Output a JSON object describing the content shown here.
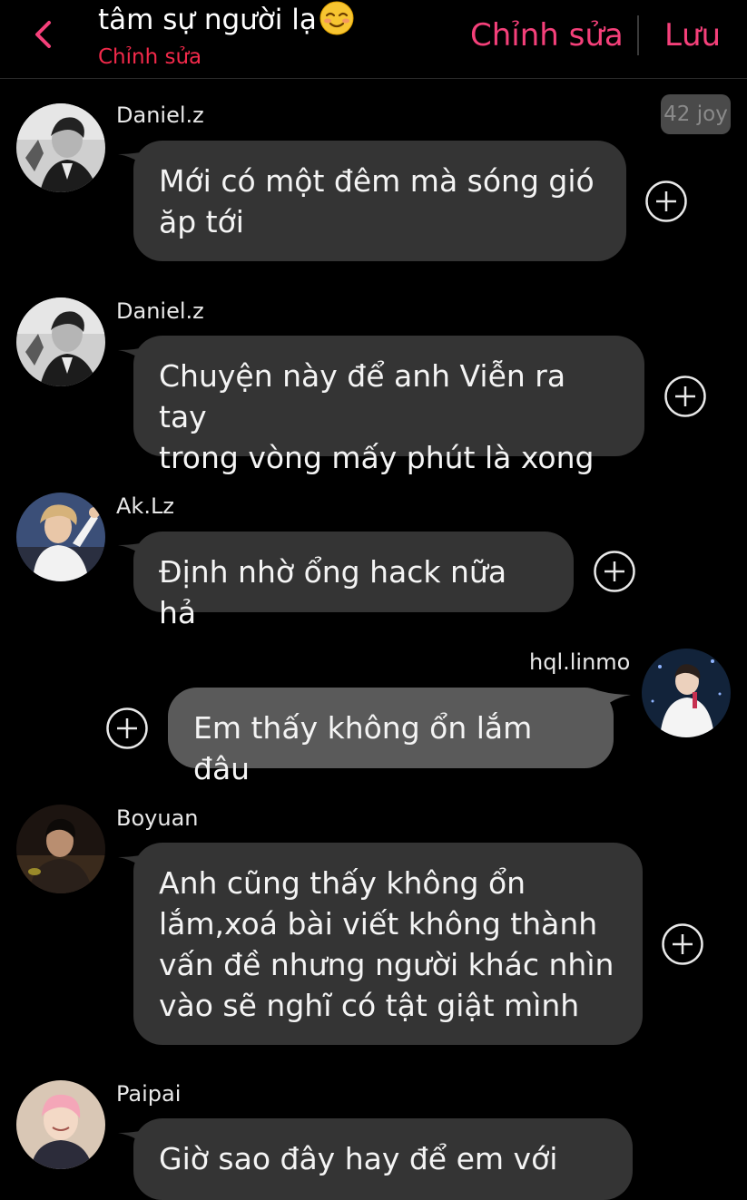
{
  "header": {
    "title": "tâm sự người lạ",
    "subtitle": "Chỉnh sửa",
    "edit_label": "Chỉnh sửa",
    "save_label": "Lưu"
  },
  "badge": "42 joy",
  "messages": [
    {
      "user": "Daniel.z",
      "text": "Mới có một đêm mà sóng gió\năp tới"
    },
    {
      "user": "Daniel.z",
      "text": "Chuyện này để anh Viễn ra tay\ntrong vòng mấy phút là xong"
    },
    {
      "user": "Ak.Lz",
      "text": "Định nhờ ổng hack nữa hả"
    },
    {
      "user": "hql.linmo",
      "text": "Em thấy không ổn lắm đâu"
    },
    {
      "user": "Boyuan",
      "text": "Anh cũng thấy không ổn\nlắm,xoá bài viết không thành\nvấn đề nhưng người khác nhìn\nvào sẽ nghĩ có tật giật mình"
    },
    {
      "user": "Paipai",
      "text": "Giờ sao đây hay để em với"
    }
  ],
  "colors": {
    "accent": "#f5407a",
    "bubble_other": "#343434",
    "bubble_mine": "#5a5a5a",
    "background": "#000000"
  }
}
